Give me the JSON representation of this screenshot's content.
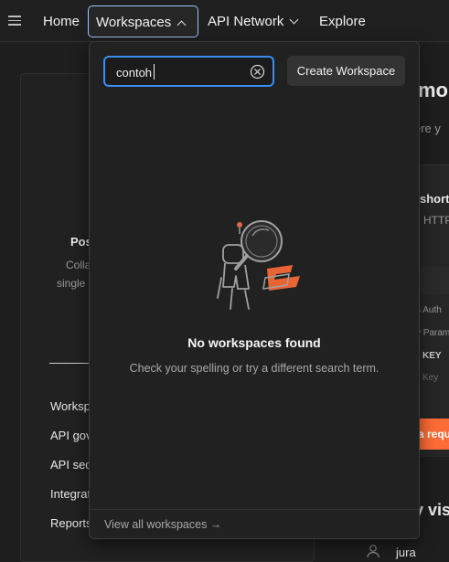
{
  "nav": {
    "home": "Home",
    "workspaces": "Workspaces",
    "api_network": "API Network",
    "explore": "Explore"
  },
  "background": {
    "card_title": "Pos",
    "card_desc_1": "Colla",
    "card_desc_2": "single",
    "links": [
      "Worksp",
      "API gov",
      "API sec",
      "Integrat",
      "Reports"
    ],
    "right_heading": "mo",
    "right_sub": "ere y",
    "right_title": "short",
    "right_http": "n HTTP",
    "right_tabs": "s   Auth",
    "right_params": "y Param",
    "right_key": "KEY",
    "right_key_placeholder": "Key",
    "right_button": "a requ",
    "right_recent": "y visi",
    "user": "jura"
  },
  "dropdown": {
    "search_value": "contoh",
    "create_button": "Create Workspace",
    "empty_title": "No workspaces found",
    "empty_subtitle": "Check your spelling or try a different search term.",
    "view_all": "View all workspaces →"
  },
  "colors": {
    "accent_blue": "#3b8cf5",
    "nav_focus": "#9fc3f7",
    "postman_orange": "#ff6c37"
  }
}
